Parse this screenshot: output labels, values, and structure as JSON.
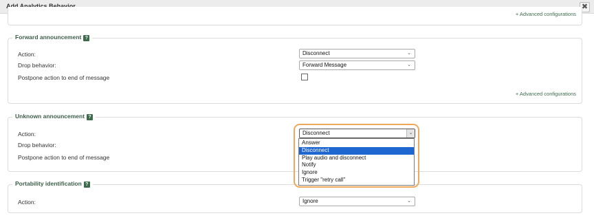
{
  "dialog": {
    "title": "Add Analytics Behavior",
    "close_symbol": "✖"
  },
  "top_section": {
    "advanced_link": "+ Advanced configurations"
  },
  "forward_announcement": {
    "title": "Forward announcement",
    "help_symbol": "?",
    "action_label": "Action:",
    "action_value": "Disconnect",
    "drop_label": "Drop behavior:",
    "drop_value": "Forward Message",
    "postpone_label": "Postpone action to end of message",
    "postpone_checked": false,
    "advanced_link": "+ Advanced configurations"
  },
  "unknown_announcement": {
    "title": "Unknown announcement",
    "help_symbol": "?",
    "action_label": "Action:",
    "action_value": "Disconnect",
    "drop_label": "Drop behavior:",
    "postpone_label": "Postpone action to end of message",
    "dropdown_options": [
      "Answer",
      "Disconnect",
      "Play audio and disconnect",
      "Notify",
      "Ignore",
      "Trigger \"retry call\""
    ],
    "dropdown_selected": "Disconnect"
  },
  "portability_identification": {
    "title": "Portability identification",
    "help_symbol": "?",
    "action_label": "Action:",
    "action_value": "Ignore"
  },
  "icons": {
    "chevron": "chevron-down-icon",
    "help": "help-icon",
    "close": "close-icon"
  },
  "colors": {
    "accent_green": "#3d6b4b",
    "highlight_orange": "#f0a85a",
    "selected_blue": "#1e66d0"
  }
}
